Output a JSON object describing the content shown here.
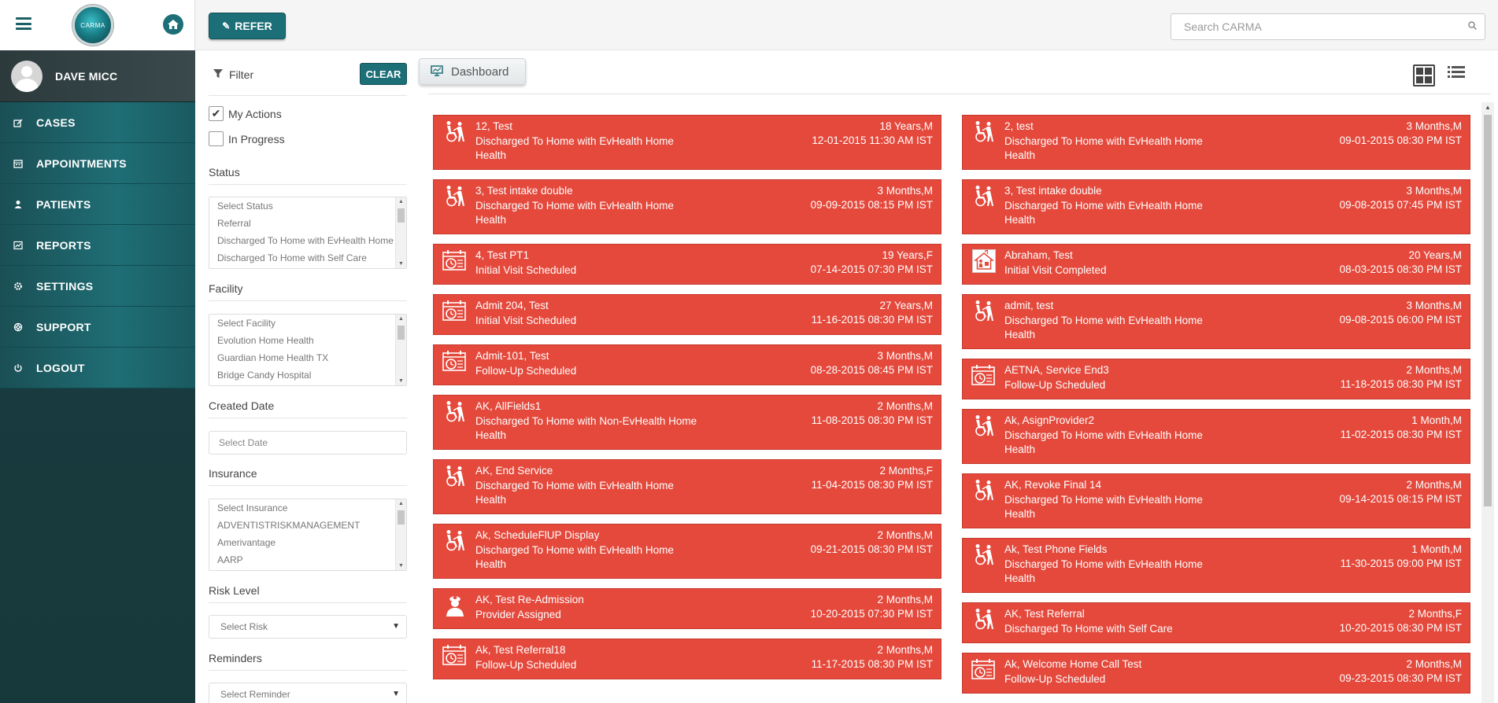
{
  "app": {
    "logo_text": "CARMA"
  },
  "user": {
    "name": "DAVE MICC"
  },
  "nav": [
    {
      "label": "CASES",
      "icon": "edit-icon"
    },
    {
      "label": "APPOINTMENTS",
      "icon": "calendar-icon"
    },
    {
      "label": "PATIENTS",
      "icon": "user-icon"
    },
    {
      "label": "REPORTS",
      "icon": "chart-icon"
    },
    {
      "label": "SETTINGS",
      "icon": "gear-icon"
    },
    {
      "label": "SUPPORT",
      "icon": "lifebuoy-icon"
    },
    {
      "label": "LOGOUT",
      "icon": "power-icon"
    }
  ],
  "topbar": {
    "refer_label": "REFER",
    "search_placeholder": "Search CARMA"
  },
  "filter": {
    "title": "Filter",
    "clear_label": "CLEAR",
    "my_actions": {
      "label": "My Actions",
      "checked": true
    },
    "in_progress": {
      "label": "In Progress",
      "checked": false
    },
    "status": {
      "title": "Status",
      "options": [
        "Select Status",
        "Referral",
        "Discharged To Home with EvHealth Home Health",
        "Discharged To Home with Self Care"
      ]
    },
    "facility": {
      "title": "Facility",
      "options": [
        "Select Facility",
        "Evolution Home Health",
        "Guardian Home Health TX",
        "Bridge Candy Hospital"
      ]
    },
    "created_date": {
      "title": "Created Date",
      "placeholder": "Select Date"
    },
    "insurance": {
      "title": "Insurance",
      "options": [
        "Select Insurance",
        "ADVENTISTRISKMANAGEMENT",
        "Amerivantage",
        "AARP"
      ]
    },
    "risk": {
      "title": "Risk Level",
      "value": "Select Risk"
    },
    "reminders": {
      "title": "Reminders",
      "value": "Select Reminder"
    }
  },
  "main": {
    "tab_label": "Dashboard",
    "colors": {
      "card": "#e4493c",
      "accent": "#1d6f77"
    },
    "left_cards": [
      {
        "name": "12, Test",
        "age": "18 Years,M",
        "status": "Discharged To Home with EvHealth Home Health",
        "date": "12-01-2015 11:30 AM IST",
        "icon": "wheelchair-icon"
      },
      {
        "name": "3, Test intake double",
        "age": "3 Months,M",
        "status": "Discharged To Home with EvHealth Home Health",
        "date": "09-09-2015 08:15 PM IST",
        "icon": "wheelchair-icon"
      },
      {
        "name": "4, Test PT1",
        "age": "19 Years,F",
        "status": "Initial Visit Scheduled",
        "date": "07-14-2015 07:30 PM IST",
        "icon": "calendar-clock-icon"
      },
      {
        "name": "Admit 204, Test",
        "age": "27 Years,M",
        "status": "Initial Visit Scheduled",
        "date": "11-16-2015 08:30 PM IST",
        "icon": "calendar-clock-icon"
      },
      {
        "name": "Admit-101, Test",
        "age": "3 Months,M",
        "status": "Follow-Up Scheduled",
        "date": "08-28-2015 08:45 PM IST",
        "icon": "calendar-clock-icon"
      },
      {
        "name": "AK, AllFields1",
        "age": "2 Months,M",
        "status": "Discharged To Home with Non-EvHealth Home Health",
        "date": "11-08-2015 08:30 PM IST",
        "icon": "wheelchair-icon"
      },
      {
        "name": "AK, End Service",
        "age": "2 Months,F",
        "status": "Discharged To Home with EvHealth Home Health",
        "date": "11-04-2015 08:30 PM IST",
        "icon": "wheelchair-icon"
      },
      {
        "name": "Ak, ScheduleFlUP Display",
        "age": "2 Months,M",
        "status": "Discharged To Home with EvHealth Home Health",
        "date": "09-21-2015 08:30 PM IST",
        "icon": "wheelchair-icon"
      },
      {
        "name": "AK, Test Re-Admission",
        "age": "2 Months,M",
        "status": "Provider Assigned",
        "date": "10-20-2015 07:30 PM IST",
        "icon": "nurse-icon"
      },
      {
        "name": "Ak, Test Referral18",
        "age": "2 Months,M",
        "status": "Follow-Up Scheduled",
        "date": "11-17-2015 08:30 PM IST",
        "icon": "calendar-clock-icon"
      }
    ],
    "right_cards": [
      {
        "name": "2, test",
        "age": "3 Months,M",
        "status": "Discharged To Home with EvHealth Home Health",
        "date": "09-01-2015 08:30 PM IST",
        "icon": "wheelchair-icon"
      },
      {
        "name": "3, Test intake double",
        "age": "3 Months,M",
        "status": "Discharged To Home with EvHealth Home Health",
        "date": "09-08-2015 07:45 PM IST",
        "icon": "wheelchair-icon"
      },
      {
        "name": "Abraham, Test",
        "age": "20 Years,M",
        "status": "Initial Visit Completed",
        "date": "08-03-2015 08:30 PM IST",
        "icon": "home-visit-icon"
      },
      {
        "name": "admit, test",
        "age": "3 Months,M",
        "status": "Discharged To Home with EvHealth Home Health",
        "date": "09-08-2015 06:00 PM IST",
        "icon": "wheelchair-icon"
      },
      {
        "name": "AETNA, Service End3",
        "age": "2 Months,M",
        "status": "Follow-Up Scheduled",
        "date": "11-18-2015 08:30 PM IST",
        "icon": "calendar-clock-icon"
      },
      {
        "name": "Ak, AsignProvider2",
        "age": "1 Month,M",
        "status": "Discharged To Home with EvHealth Home Health",
        "date": "11-02-2015 08:30 PM IST",
        "icon": "wheelchair-icon"
      },
      {
        "name": "AK, Revoke Final 14",
        "age": "2 Months,M",
        "status": "Discharged To Home with EvHealth Home Health",
        "date": "09-14-2015 08:15 PM IST",
        "icon": "wheelchair-icon"
      },
      {
        "name": "Ak, Test Phone Fields",
        "age": "1 Month,M",
        "status": "Discharged To Home with EvHealth Home Health",
        "date": "11-30-2015 09:00 PM IST",
        "icon": "wheelchair-icon"
      },
      {
        "name": "AK, Test Referral",
        "age": "2 Months,F",
        "status": "Discharged To Home with Self Care",
        "date": "10-20-2015 08:30 PM IST",
        "icon": "wheelchair-icon"
      },
      {
        "name": "Ak, Welcome Home Call Test",
        "age": "2 Months,M",
        "status": "Follow-Up Scheduled",
        "date": "09-23-2015 08:30 PM IST",
        "icon": "calendar-clock-icon"
      }
    ]
  }
}
